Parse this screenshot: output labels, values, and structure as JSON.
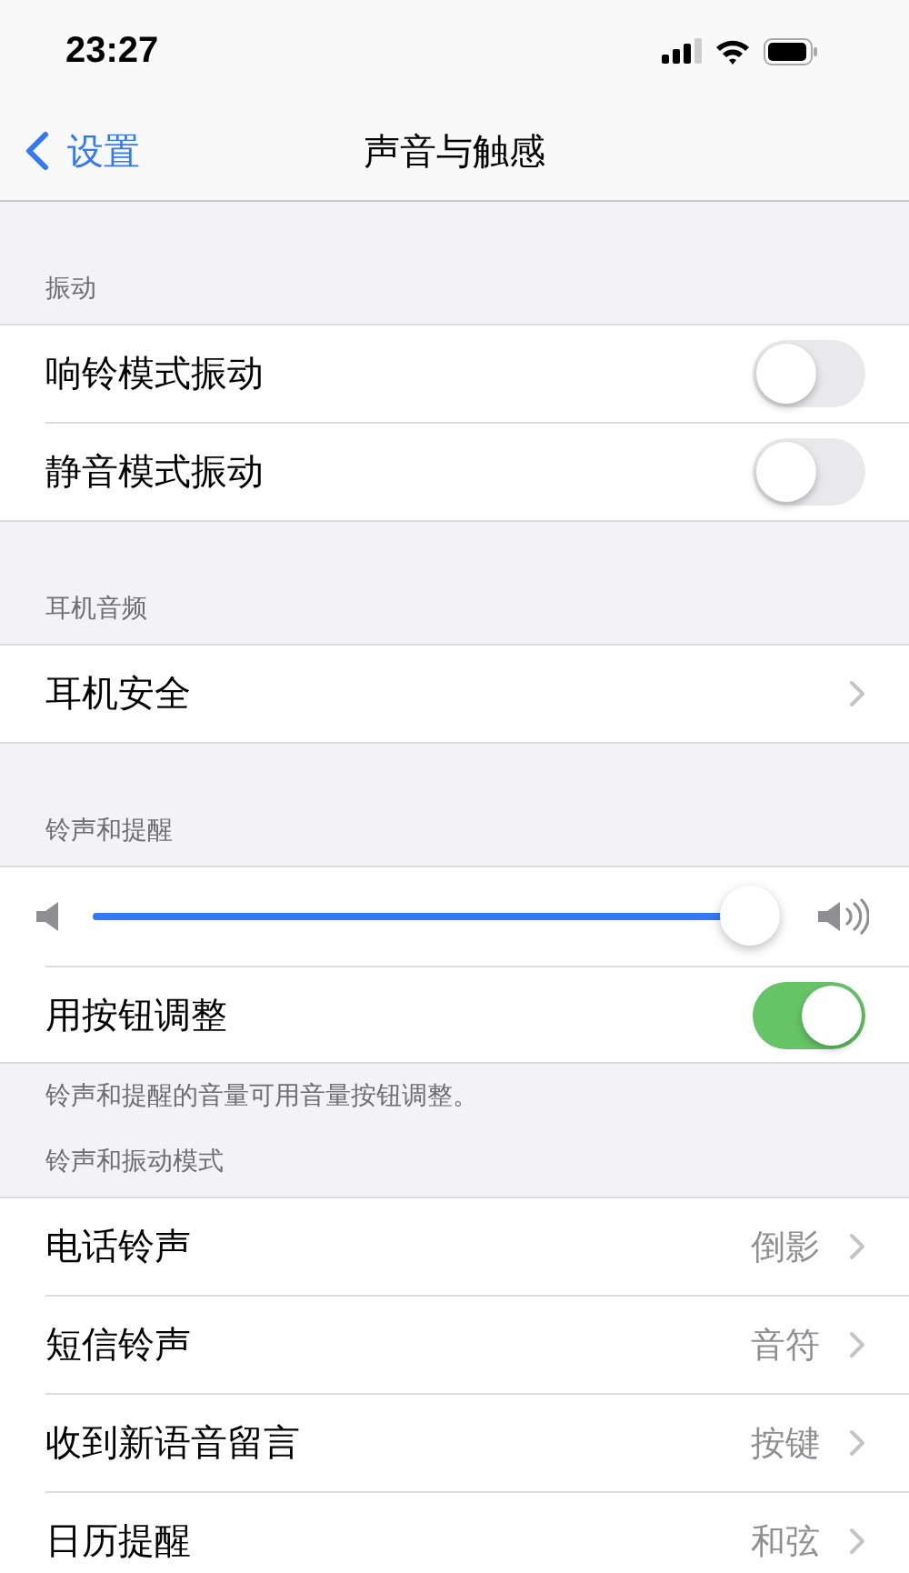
{
  "status_bar": {
    "time": "23:27"
  },
  "nav": {
    "back": "设置",
    "title": "声音与触感"
  },
  "sections": [
    {
      "header": "振动",
      "rows": [
        {
          "kind": "toggle",
          "label": "响铃模式振动",
          "on": false
        },
        {
          "kind": "toggle",
          "label": "静音模式振动",
          "on": false
        }
      ]
    },
    {
      "header": "耳机音频",
      "rows": [
        {
          "kind": "link",
          "label": "耳机安全"
        }
      ]
    },
    {
      "header": "铃声和提醒",
      "rows": [
        {
          "kind": "slider",
          "level": 1
        },
        {
          "kind": "toggle",
          "label": "用按钮调整",
          "on": true
        }
      ],
      "footer": "铃声和提醒的音量可用音量按钮调整。"
    },
    {
      "header": "铃声和振动模式",
      "rows": [
        {
          "kind": "link",
          "label": "电话铃声",
          "value": "倒影"
        },
        {
          "kind": "link",
          "label": "短信铃声",
          "value": "音符"
        },
        {
          "kind": "link",
          "label": "收到新语音留言",
          "value": "按键"
        },
        {
          "kind": "link",
          "label": "日历提醒",
          "value": "和弦"
        }
      ]
    }
  ]
}
